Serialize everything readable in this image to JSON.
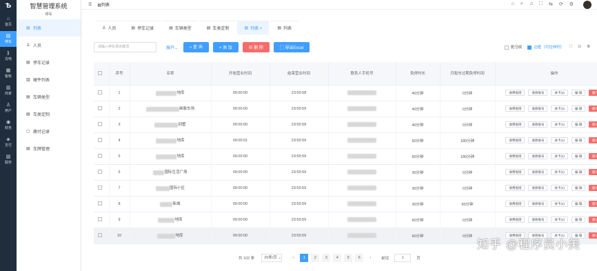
{
  "rail": {
    "logo": "Ѣ",
    "items": [
      {
        "icon": "⌂",
        "label": "首页"
      },
      {
        "icon": "▤",
        "label": "停车",
        "active": true
      },
      {
        "icon": "⟫",
        "label": "充电"
      },
      {
        "icon": "▦",
        "label": "客帐"
      },
      {
        "icon": "▥",
        "label": "商家"
      },
      {
        "icon": "♙",
        "label": "用户"
      },
      {
        "icon": "◉",
        "label": "财务"
      },
      {
        "icon": "◈",
        "label": "支付"
      },
      {
        "icon": "▧",
        "label": "服务"
      }
    ]
  },
  "sidebar": {
    "title": "智慧管理系统",
    "subtitle": "停车",
    "items": [
      {
        "icon": "▤",
        "label": "列表",
        "active": true
      },
      {
        "icon": "♙",
        "label": "人员"
      },
      {
        "icon": "▤",
        "label": "停车记录"
      },
      {
        "icon": "▥",
        "label": "硬件列表"
      },
      {
        "icon": "▤",
        "label": "车辆类型"
      },
      {
        "icon": "▤",
        "label": "车类定制"
      },
      {
        "icon": "▢",
        "label": "缴付记录"
      },
      {
        "icon": "▤",
        "label": "车牌管理"
      }
    ]
  },
  "topbar": {
    "menu_icon": "☰",
    "breadcrumb": "▤列表",
    "icons": [
      "⌂",
      "⌕",
      "♫",
      "⛶",
      "⇆",
      "⟳",
      "⚙"
    ]
  },
  "tabs": [
    {
      "icon": "♙",
      "label": "人员"
    },
    {
      "icon": "▤",
      "label": "停车记录"
    },
    {
      "icon": "▤",
      "label": "车辆类型"
    },
    {
      "icon": "▤",
      "label": "车类定制"
    },
    {
      "icon": "▤",
      "label": "列表 ×",
      "active": true
    },
    {
      "icon": "▤",
      "label": "列表"
    }
  ],
  "toolbar": {
    "search_placeholder": "请输入停车场关键词",
    "expand": "展开⌄",
    "query": "⌕ 查 询",
    "add": "+ 添 加",
    "delete": "⊗ 删 除",
    "export": "▢ 导出Excel",
    "opt_zebra": "斑马纹",
    "opt_border": "边框（可拉伸列）",
    "icons": [
      "⛶",
      "☷",
      "⚙"
    ]
  },
  "table": {
    "columns": [
      "序号",
      "名称",
      "开始营业时间",
      "结束营业时间",
      "联系人手机号",
      "免停时长",
      "月租车过期免停时间",
      "操作"
    ],
    "actions": [
      "收费规则",
      "收款账号",
      "关卡(N)",
      "编 辑",
      "删 除"
    ],
    "rows": [
      {
        "no": "1",
        "name": "地库",
        "start": "00:00:00",
        "end": "23:59:58",
        "free": "40分钟",
        "expire": "0分钟",
        "gate": "关卡(4)"
      },
      {
        "no": "2",
        "name": "画像车场",
        "start": "00:00:00",
        "end": "23:59:59",
        "free": "40分钟",
        "expire": "0分钟",
        "gate": "关卡(3)"
      },
      {
        "no": "3",
        "name": "别墅",
        "start": "00:00:00",
        "end": "23:59:58",
        "free": "40分钟",
        "expire": "0分钟",
        "gate": "关卡(4)"
      },
      {
        "no": "4",
        "name": "地库",
        "start": "00:00:01",
        "end": "23:59:59",
        "free": "60分钟",
        "expire": "180分钟",
        "gate": "关卡(4)"
      },
      {
        "no": "5",
        "name": "地库",
        "start": "00:00:00",
        "end": "23:59:59",
        "free": "60分钟",
        "expire": "180分钟",
        "gate": "关卡(4)"
      },
      {
        "no": "6",
        "name": "国际生活广场",
        "start": "00:00:00",
        "end": "23:59:59",
        "free": "30分钟",
        "expire": "0分钟",
        "gate": "关卡(2)"
      },
      {
        "no": "7",
        "name": "国际小区",
        "start": "00:00:00",
        "end": "23:59:59",
        "free": "30分钟",
        "expire": "0分钟",
        "gate": "关卡(4)"
      },
      {
        "no": "8",
        "name": "新城",
        "start": "00:00:00",
        "end": "23:59:59",
        "free": "30分钟",
        "expire": "60分钟",
        "gate": "关卡(4)"
      },
      {
        "no": "9",
        "name": "地库",
        "start": "00:00:00",
        "end": "23:59:59",
        "free": "60分钟",
        "expire": "0分钟",
        "gate": "关卡(4)"
      },
      {
        "no": "10",
        "name": "地库",
        "start": "00:00:00",
        "end": "23:59:59",
        "free": "60分钟",
        "expire": "0分钟",
        "gate": "关卡(4)",
        "highlight": true
      }
    ]
  },
  "pagination": {
    "total": "共 102 条",
    "page_size": "20条/页 ⌄",
    "prev": "‹",
    "pages": [
      "1",
      "2",
      "3",
      "4",
      "5",
      "6"
    ],
    "next": "›",
    "goto_label": "前往",
    "goto_value": "1",
    "goto_unit": "页"
  },
  "watermark": "知乎 @程序员小美"
}
